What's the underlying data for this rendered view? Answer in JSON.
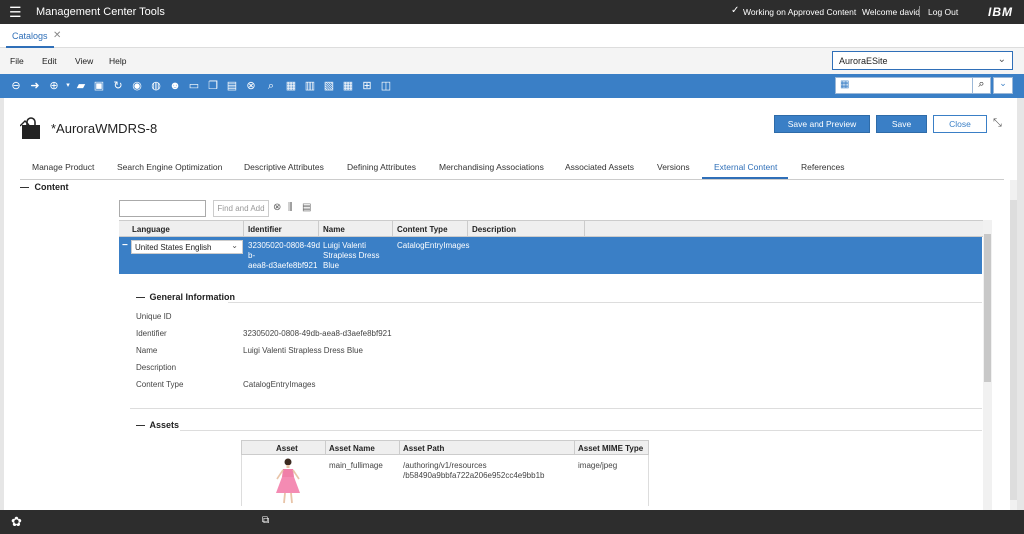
{
  "topbar": {
    "app_title": "Management Center Tools",
    "status_text": "Working on Approved Content",
    "welcome_text": "Welcome david",
    "logout_label": "Log Out",
    "brand": "IBM"
  },
  "tabs": [
    {
      "label": "Catalogs"
    }
  ],
  "menu": {
    "file": "File",
    "edit": "Edit",
    "view": "View",
    "help": "Help"
  },
  "store": {
    "selected": "AuroraESite"
  },
  "object": {
    "title": "*AuroraWMDRS-8"
  },
  "actions": {
    "save_and_preview": "Save and Preview",
    "save": "Save",
    "close": "Close"
  },
  "page_tabs": [
    {
      "label": "Manage Product"
    },
    {
      "label": "Search Engine Optimization"
    },
    {
      "label": "Descriptive Attributes"
    },
    {
      "label": "Defining Attributes"
    },
    {
      "label": "Merchandising Associations"
    },
    {
      "label": "Associated Assets"
    },
    {
      "label": "Versions"
    },
    {
      "label": "External Content",
      "active": true
    },
    {
      "label": "References"
    }
  ],
  "content": {
    "section_label": "Content",
    "filter_value": "",
    "find_button": "Find and Add",
    "columns": [
      "Language",
      "Identifier",
      "Name",
      "Content Type",
      "Description"
    ],
    "row": {
      "toggle": "−",
      "language": "United States English",
      "identifier_lines": [
        "32305020-0808-49d",
        "b-",
        "aea8-d3aefe8bf921"
      ],
      "name_lines": [
        "Luigi Valenti",
        "Strapless Dress",
        "Blue"
      ],
      "content_type": "CatalogEntryImages",
      "description": ""
    },
    "general": {
      "title": "General Information",
      "labels": {
        "unique_id": "Unique ID",
        "identifier": "Identifier",
        "name": "Name",
        "description": "Description",
        "content_type": "Content Type"
      },
      "values": {
        "unique_id": "",
        "identifier": "32305020-0808-49db-aea8-d3aefe8bf921",
        "name": "Luigi Valenti Strapless Dress Blue",
        "description": "",
        "content_type": "CatalogEntryImages"
      }
    },
    "assets": {
      "title": "Assets",
      "columns": [
        "Asset",
        "Asset Name",
        "Asset Path",
        "Asset MIME Type"
      ],
      "row": {
        "asset_name": "main_fullimage",
        "asset_path_lines": [
          "/authoring/v1/resources",
          "/b58490a9bbfa722a206e952cc4e9bb1b"
        ],
        "mime_type": "image/jpeg"
      }
    }
  }
}
